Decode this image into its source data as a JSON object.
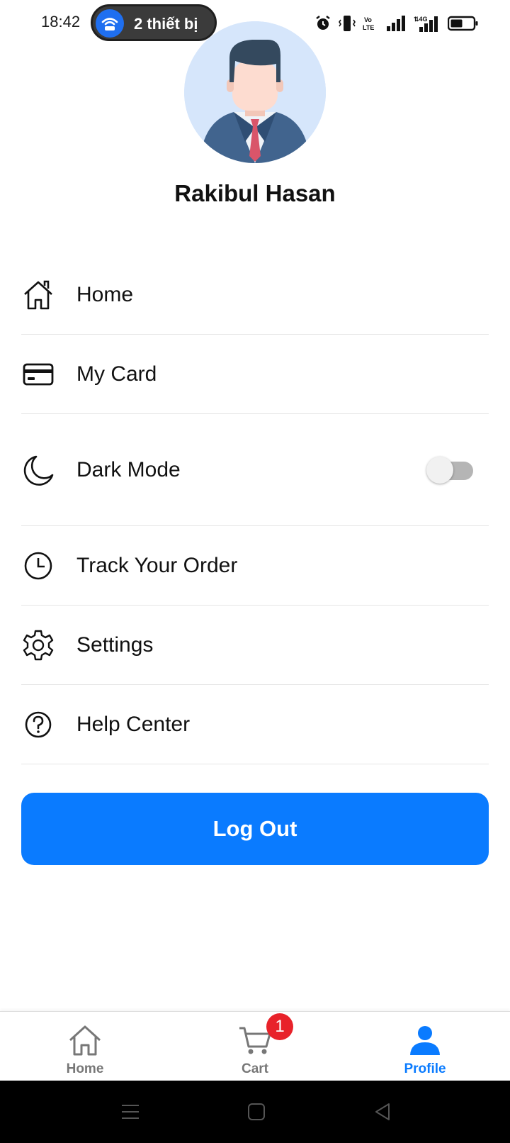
{
  "status_bar": {
    "time": "18:42",
    "hotspot_label": "2 thiết bị",
    "icons": [
      "wifi-hotspot-icon",
      "alarm-icon",
      "vibrate-icon",
      "volte-icon",
      "signal-icon",
      "signal-4g-icon",
      "battery-icon"
    ]
  },
  "profile": {
    "name": "Rakibul Hasan",
    "avatar": "user-avatar-illustration"
  },
  "menu": {
    "items": [
      {
        "label": "Home",
        "icon": "home-icon"
      },
      {
        "label": "My Card",
        "icon": "card-icon"
      },
      {
        "label": "Dark Mode",
        "icon": "moon-icon",
        "toggle_on": false
      },
      {
        "label": "Track Your Order",
        "icon": "clock-icon"
      },
      {
        "label": "Settings",
        "icon": "gear-icon"
      },
      {
        "label": "Help Center",
        "icon": "help-icon"
      }
    ]
  },
  "logout_label": "Log Out",
  "bottom_nav": {
    "items": [
      {
        "label": "Home",
        "icon": "home-icon",
        "active": false
      },
      {
        "label": "Cart",
        "icon": "cart-icon",
        "active": false,
        "badge": "1"
      },
      {
        "label": "Profile",
        "icon": "person-icon",
        "active": true
      }
    ]
  },
  "colors": {
    "accent": "#0a7bff",
    "badge": "#e8222a",
    "inactive_nav": "#777777"
  }
}
